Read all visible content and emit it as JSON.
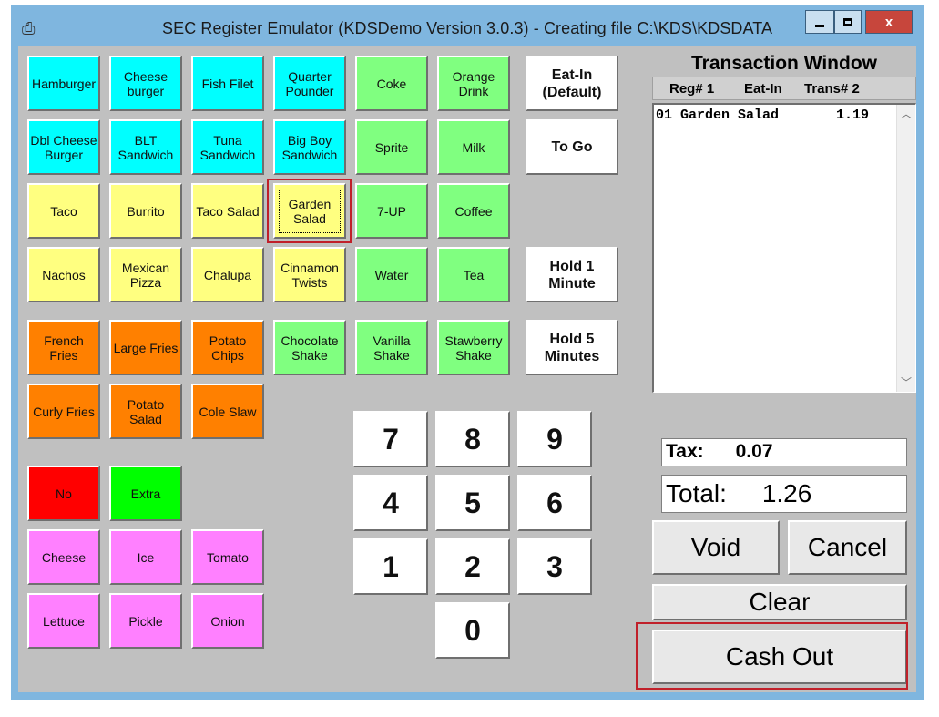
{
  "window": {
    "title": "SEC Register Emulator (KDSDemo Version 3.0.3) - Creating file C:\\KDS\\KDSDATA",
    "close_label": "x",
    "app_icon": "printer-icon"
  },
  "menu_items": {
    "hamburger": "Hamburger",
    "cheeseburger": "Cheese\nburger",
    "fish_filet": "Fish Filet",
    "quarter_pounder": "Quarter\nPounder",
    "coke": "Coke",
    "orange_drink": "Orange\nDrink",
    "dbl_cheese_burger": "Dbl Cheese\nBurger",
    "blt_sandwich": "BLT\nSandwich",
    "tuna_sandwich": "Tuna\nSandwich",
    "big_boy_sandwich": "Big Boy\nSandwich",
    "sprite": "Sprite",
    "milk": "Milk",
    "taco": "Taco",
    "burrito": "Burrito",
    "taco_salad": "Taco Salad",
    "garden_salad": "Garden\nSalad",
    "seven_up": "7-UP",
    "coffee": "Coffee",
    "nachos": "Nachos",
    "mexican_pizza": "Mexican\nPizza",
    "chalupa": "Chalupa",
    "cinnamon_twists": "Cinnamon\nTwists",
    "water": "Water",
    "tea": "Tea",
    "french_fries": "French\nFries",
    "large_fries": "Large Fries",
    "potato_chips": "Potato\nChips",
    "chocolate_shake": "Chocolate\nShake",
    "vanilla_shake": "Vanilla\nShake",
    "strawberry_shake": "Stawberry\nShake",
    "curly_fries": "Curly Fries",
    "potato_salad": "Potato\nSalad",
    "cole_slaw": "Cole Slaw"
  },
  "modifiers": {
    "no": "No",
    "extra": "Extra",
    "cheese": "Cheese",
    "ice": "Ice",
    "tomato": "Tomato",
    "lettuce": "Lettuce",
    "pickle": "Pickle",
    "onion": "Onion"
  },
  "order_options": {
    "eat_in": "Eat-In\n(Default)",
    "to_go": "To Go",
    "hold_1": "Hold 1\nMinute",
    "hold_5": "Hold 5\nMinutes"
  },
  "keypad": [
    "7",
    "8",
    "9",
    "4",
    "5",
    "6",
    "1",
    "2",
    "3",
    "0"
  ],
  "transaction": {
    "title": "Transaction Window",
    "reg": "Reg# 1",
    "mode": "Eat-In",
    "trans": "Trans# 2",
    "lines": [
      "01 Garden Salad       1.19"
    ]
  },
  "totals": {
    "tax": "Tax:      0.07",
    "total": "Total:     1.26"
  },
  "actions": {
    "void": "Void",
    "cancel": "Cancel",
    "clear": "Clear",
    "cash_out": "Cash Out"
  },
  "colors": {
    "sandwich": "#00ffff",
    "drink": "#80ff80",
    "mexican": "#ffff80",
    "side": "#ff8000",
    "no": "#ff0000",
    "extra": "#00ff00",
    "condiment": "#ff80ff",
    "highlight": "#c0202a"
  }
}
